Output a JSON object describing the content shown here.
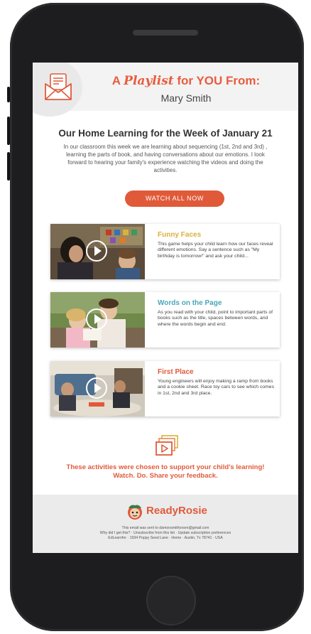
{
  "header": {
    "title_prefix": "A ",
    "title_playlist": "Playlist",
    "title_suffix": " for YOU From:",
    "sender": "Mary Smith"
  },
  "intro": {
    "title": "Our Home Learning for the Week of January 21",
    "body": "In our classroom this week we are learning about sequencing (1st, 2nd and 3rd) , learning the parts of book, and having conversations about our emotions. I look forward to hearing your family's experience watching the videos and doing the activities.",
    "watch_all_label": "WATCH ALL NOW"
  },
  "videos": [
    {
      "title": "Funny Faces",
      "description": "This game helps your child learn how our faces reveal different emotions. Say a sentence such as \"My birthday is tomorrow!\" and ask your child...",
      "title_color": "#d8b23a"
    },
    {
      "title": "Words on the Page",
      "description": "As you read with your child, point to important parts of books such as the title, spaces between words, and where the words begin and end.",
      "title_color": "#4aa6b8"
    },
    {
      "title": "First Place",
      "description": "Young engineers will enjoy making a ramp from books and a cookie sheet. Race toy cars to see which comes in 1st, 2nd and 3rd place.",
      "title_color": "#e05a3a"
    }
  ],
  "support": {
    "line1": "These activities were chosen to support your child's learning!",
    "line2": "Watch. Do. Share your feedback."
  },
  "footer": {
    "brand": "ReadyRosie",
    "line1": "This email was sent to damonsmithorsen@gmail.com",
    "line2_why": "Why did I get this?",
    "line2_unsub": "Unsubscribe from this list",
    "line2_update": "Update subscription preferences",
    "line3": "EdLearnfor · 1934 Poppy Seed Lane · Home · Austin, Tx 78741 · USA"
  },
  "colors": {
    "accent": "#e05a3a",
    "yellow_title": "#d8b23a",
    "teal_title": "#4aa6b8",
    "phone": "#1d1d1f"
  }
}
